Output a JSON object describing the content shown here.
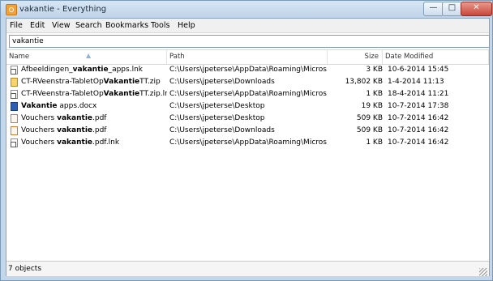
{
  "window": {
    "title": "vakantie - Everything",
    "buttons": {
      "minimize": "—",
      "maximize": "□",
      "close": "✕"
    }
  },
  "menu": [
    "File",
    "Edit",
    "View",
    "Search",
    "Bookmarks",
    "Tools",
    "Help"
  ],
  "search": {
    "value": "vakantie"
  },
  "columns": {
    "name": "Name",
    "path": "Path",
    "size": "Size",
    "date": "Date Modified"
  },
  "rows": [
    {
      "icon": "lnk",
      "name_before": "Afbeeldingen_",
      "name_match": "vakantie",
      "name_after": "_apps.lnk",
      "path": "C:\\Users\\jpeterse\\AppData\\Roaming\\Micros...",
      "size": "3 KB",
      "date": "10-6-2014 15:45"
    },
    {
      "icon": "folder",
      "name_before": "CT-RVeenstra-TabletOp",
      "name_match": "Vakantie",
      "name_after": "TT.zip",
      "path": "C:\\Users\\jpeterse\\Downloads",
      "size": "13,802 KB",
      "date": "1-4-2014 11:13"
    },
    {
      "icon": "lnk",
      "name_before": "CT-RVeenstra-TabletOp",
      "name_match": "Vakantie",
      "name_after": "TT.zip.lnk",
      "path": "C:\\Users\\jpeterse\\AppData\\Roaming\\Micros...",
      "size": "1 KB",
      "date": "18-4-2014 11:21"
    },
    {
      "icon": "doc",
      "name_before": "",
      "name_match": "Vakantie",
      "name_after": " apps.docx",
      "path": "C:\\Users\\jpeterse\\Desktop",
      "size": "19 KB",
      "date": "10-7-2014 17:38"
    },
    {
      "icon": "pdf",
      "name_before": "Vouchers ",
      "name_match": "vakantie",
      "name_after": ".pdf",
      "path": "C:\\Users\\jpeterse\\Desktop",
      "size": "509 KB",
      "date": "10-7-2014 16:42"
    },
    {
      "icon": "pdf",
      "name_before": "Vouchers ",
      "name_match": "vakantie",
      "name_after": ".pdf",
      "path": "C:\\Users\\jpeterse\\Downloads",
      "size": "509 KB",
      "date": "10-7-2014 16:42"
    },
    {
      "icon": "lnk",
      "name_before": "Vouchers ",
      "name_match": "vakantie",
      "name_after": ".pdf.lnk",
      "path": "C:\\Users\\jpeterse\\AppData\\Roaming\\Micros...",
      "size": "1 KB",
      "date": "10-7-2014 16:42"
    }
  ],
  "status": {
    "text": "7 objects"
  }
}
